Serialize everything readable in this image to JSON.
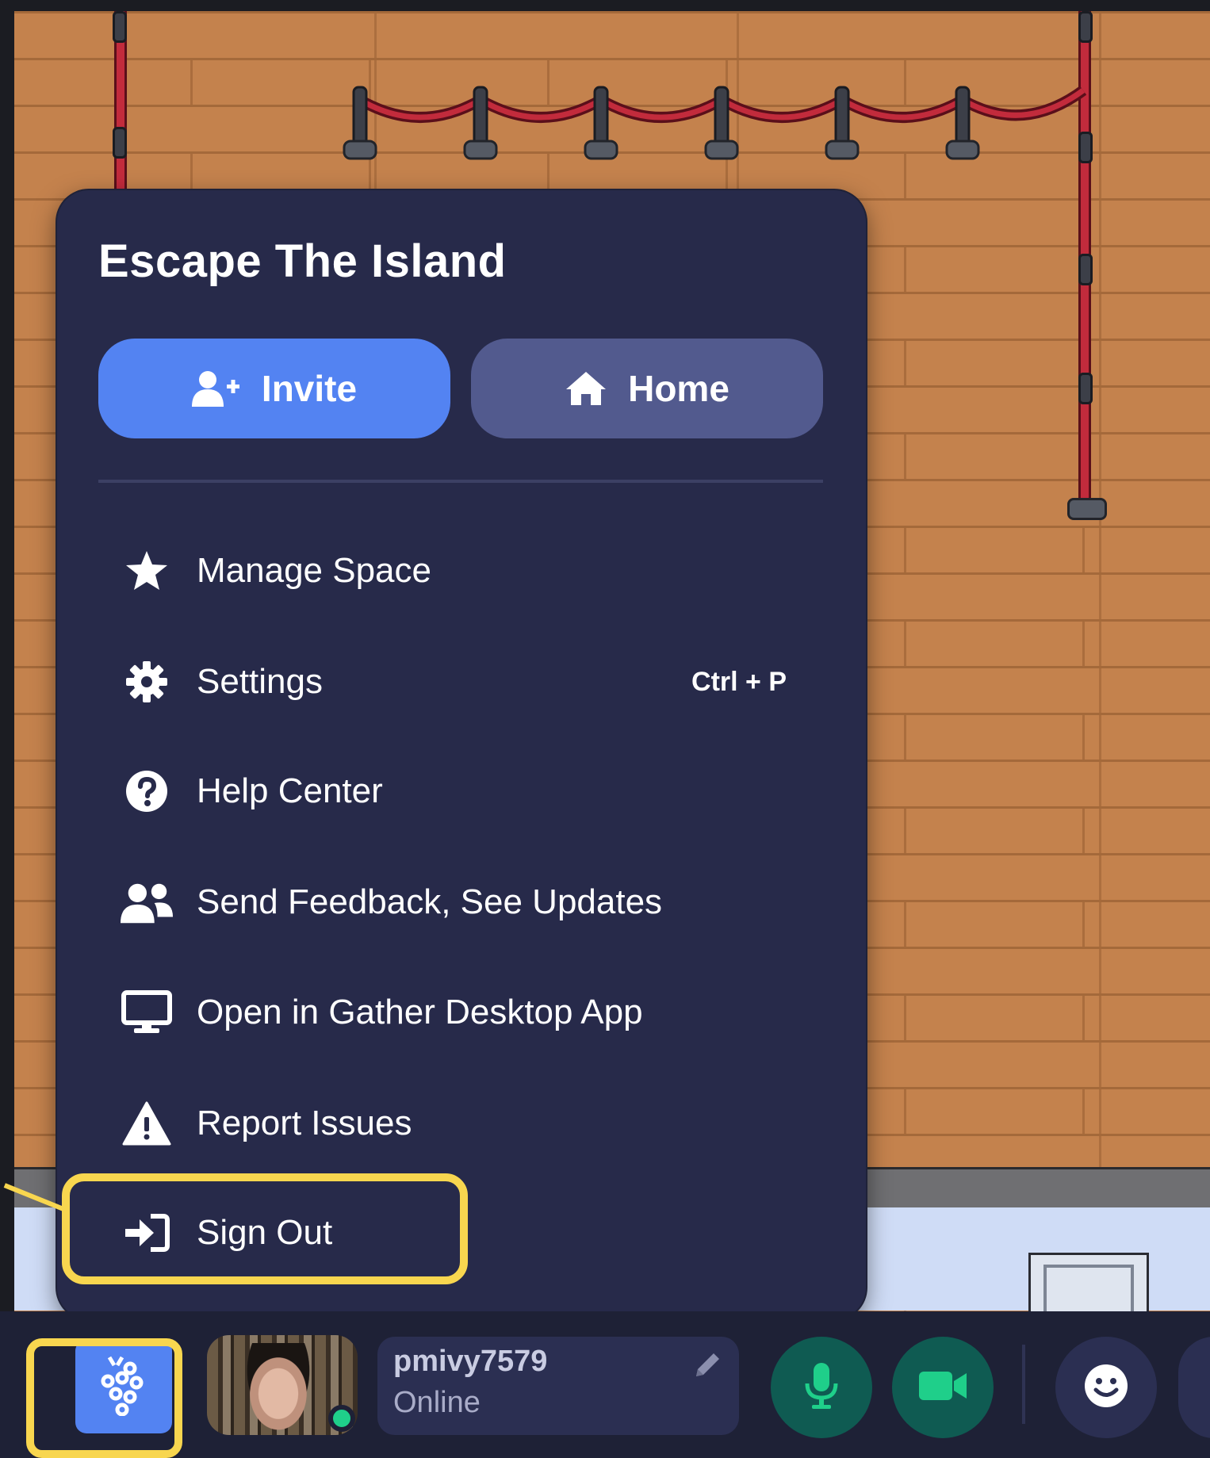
{
  "menu": {
    "title": "Escape The Island",
    "invite_label": "Invite",
    "home_label": "Home",
    "items": [
      {
        "label": "Manage Space",
        "icon": "star-icon",
        "shortcut": ""
      },
      {
        "label": "Settings",
        "icon": "gear-icon",
        "shortcut": "Ctrl + P"
      },
      {
        "label": "Help Center",
        "icon": "question-circle-icon",
        "shortcut": ""
      },
      {
        "label": "Send Feedback, See Updates",
        "icon": "users-icon",
        "shortcut": ""
      },
      {
        "label": "Open in Gather Desktop App",
        "icon": "desktop-icon",
        "shortcut": ""
      },
      {
        "label": "Report Issues",
        "icon": "warning-icon",
        "shortcut": ""
      },
      {
        "label": "Sign Out",
        "icon": "sign-out-icon",
        "shortcut": ""
      }
    ]
  },
  "user": {
    "name": "pmivy7579",
    "status": "Online"
  },
  "colors": {
    "menu_bg": "#272a4a",
    "invite_bg": "#5383f2",
    "home_bg": "#525a8e",
    "highlight": "#f8d64f",
    "online": "#1fcf8a",
    "media_on": "#0f5b52"
  }
}
